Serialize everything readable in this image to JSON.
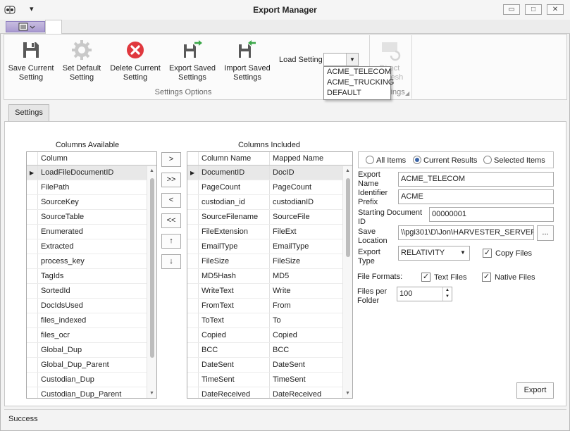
{
  "window": {
    "title": "Export Manager",
    "minimize_glyph": "▭",
    "maximize_glyph": "□",
    "close_glyph": "✕"
  },
  "qat": {
    "dropdown_glyph": "▾"
  },
  "ribbon": {
    "buttons": [
      {
        "label1": "Save Current",
        "label2": "Setting",
        "icon": "floppy-icon"
      },
      {
        "label1": "Set Default",
        "label2": "Setting",
        "icon": "gear-icon"
      },
      {
        "label1": "Delete Current",
        "label2": "Setting",
        "icon": "delete-icon"
      },
      {
        "label1": "Export Saved",
        "label2": "Settings",
        "icon": "export-icon"
      },
      {
        "label1": "Import Saved",
        "label2": "Settings",
        "icon": "import-icon"
      }
    ],
    "group_label": "Settings Options",
    "load_setting_label": "Load Setting",
    "load_setting_options": [
      "ACME_TELECOM",
      "ACME_TRUCKING",
      "DEFAULT"
    ],
    "refresh_label1": "Direct",
    "refresh_label2": "Refresh",
    "refresh_group_label": "Settings"
  },
  "settings_tab": "Settings",
  "available": {
    "title": "Columns Available",
    "header": "Column",
    "rows": [
      "LoadFileDocumentID",
      "FilePath",
      "SourceKey",
      "SourceTable",
      "Enumerated",
      "Extracted",
      "process_key",
      "TagIds",
      "SortedId",
      "DocIdsUsed",
      "files_indexed",
      "files_ocr",
      "Global_Dup",
      "Global_Dup_Parent",
      "Custodian_Dup",
      "Custodian_Dup_Parent"
    ]
  },
  "move_buttons": [
    ">",
    ">>",
    "<",
    "<<",
    "↑",
    "↓"
  ],
  "included": {
    "title": "Columns Included",
    "header_name": "Column Name",
    "header_mapped": "Mapped Name",
    "rows": [
      [
        "DocumentID",
        "DocID"
      ],
      [
        "PageCount",
        "PageCount"
      ],
      [
        "custodian_id",
        "custodianID"
      ],
      [
        "SourceFilename",
        "SourceFile"
      ],
      [
        "FileExtension",
        "FileExt"
      ],
      [
        "EmailType",
        "EmailType"
      ],
      [
        "FileSize",
        "FileSize"
      ],
      [
        "MD5Hash",
        "MD5"
      ],
      [
        "WriteText",
        "Write"
      ],
      [
        "FromText",
        "From"
      ],
      [
        "ToText",
        "To"
      ],
      [
        "Copied",
        "Copied"
      ],
      [
        "BCC",
        "BCC"
      ],
      [
        "DateSent",
        "DateSent"
      ],
      [
        "TimeSent",
        "TimeSent"
      ],
      [
        "DateReceived",
        "DateReceived"
      ]
    ]
  },
  "scope": {
    "options": [
      "All Items",
      "Current Results",
      "Selected Items"
    ],
    "selected": "Current Results"
  },
  "form": {
    "export_name_l1": "Export",
    "export_name_l2": "Name",
    "export_name": "ACME_TELECOM",
    "prefix_l1": "Identifier",
    "prefix_l2": "Prefix",
    "prefix": "ACME",
    "start_l1": "Starting Document",
    "start_l2": "ID",
    "start": "00000001",
    "save_l1": "Save",
    "save_l2": "Location",
    "save": "\\\\pgi301\\D\\Jon\\HARVESTER_SERVER_",
    "browse": "...",
    "type_l1": "Export",
    "type_l2": "Type",
    "type": "RELATIVITY",
    "copy_files": "Copy Files",
    "file_formats": "File Formats:",
    "text_files": "Text Files",
    "native_files": "Native Files",
    "per_folder_l1": "Files per",
    "per_folder_l2": "Folder",
    "per_folder": "100"
  },
  "export_button": "Export",
  "status": "Success"
}
